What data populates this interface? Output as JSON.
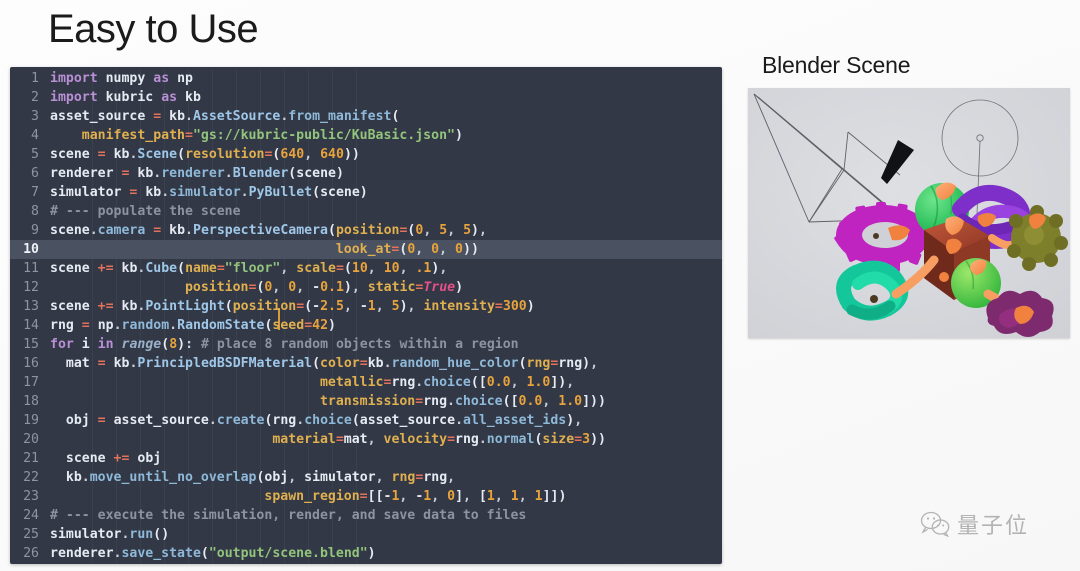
{
  "slide": {
    "title": "Easy to Use",
    "scene_heading": "Blender Scene"
  },
  "watermark": {
    "icon": "wechat-icon",
    "text": "量子位"
  },
  "code_panel": {
    "language": "python",
    "current_line": 10,
    "caret_line": 10,
    "theme": {
      "background": "#323845",
      "current_line_background": "#4a5161",
      "foreground": "#e6eaf2",
      "line_number": "#8d94a3",
      "keyword": "#b98fd6",
      "attribute": "#8fb9d9",
      "string": "#93c47d",
      "number": "#e8a33d",
      "kwarg": "#e0b050",
      "operator": "#e2725b",
      "comment": "#8c93a1",
      "boolean": "#e3508a",
      "caret": "#d99a3a"
    },
    "lines": [
      {
        "n": 1,
        "text": "import numpy as np"
      },
      {
        "n": 2,
        "text": "import kubric as kb"
      },
      {
        "n": 3,
        "text": "asset_source = kb.AssetSource.from_manifest("
      },
      {
        "n": 4,
        "text": "    manifest_path=\"gs://kubric-public/KuBasic.json\")"
      },
      {
        "n": 5,
        "text": "scene = kb.Scene(resolution=(640, 640))"
      },
      {
        "n": 6,
        "text": "renderer = kb.renderer.Blender(scene)"
      },
      {
        "n": 7,
        "text": "simulator = kb.simulator.PyBullet(scene)"
      },
      {
        "n": 8,
        "text": "# --- populate the scene"
      },
      {
        "n": 9,
        "text": "scene.camera = kb.PerspectiveCamera(position=(0, 5, 5),"
      },
      {
        "n": 10,
        "text": "                                    look_at=(0, 0, 0))"
      },
      {
        "n": 11,
        "text": "scene += kb.Cube(name=\"floor\", scale=(10, 10, .1),"
      },
      {
        "n": 12,
        "text": "                 position=(0, 0, -0.1), static=True)"
      },
      {
        "n": 13,
        "text": "scene += kb.PointLight(position=(-2.5, -1, 5), intensity=300)"
      },
      {
        "n": 14,
        "text": "rng = np.random.RandomState(seed=42)"
      },
      {
        "n": 15,
        "text": "for i in range(8): # place 8 random objects within a region"
      },
      {
        "n": 16,
        "text": "  mat = kb.PrincipledBSDFMaterial(color=kb.random_hue_color(rng=rng),"
      },
      {
        "n": 17,
        "text": "                                  metallic=rng.choice([0.0, 1.0]),"
      },
      {
        "n": 18,
        "text": "                                  transmission=rng.choice([0.0, 1.0]))"
      },
      {
        "n": 19,
        "text": "  obj = asset_source.create(rng.choice(asset_source.all_asset_ids),"
      },
      {
        "n": 20,
        "text": "                            material=mat, velocity=rng.normal(size=3))"
      },
      {
        "n": 21,
        "text": "  scene += obj"
      },
      {
        "n": 22,
        "text": "  kb.move_until_no_overlap(obj, simulator, rng=rng,"
      },
      {
        "n": 23,
        "text": "                           spawn_region=[[-1, -1, 0], [1, 1, 1]])"
      },
      {
        "n": 24,
        "text": "# --- execute the simulation, render, and save data to files"
      },
      {
        "n": 25,
        "text": "simulator.run()"
      },
      {
        "n": 26,
        "text": "renderer.save_state(\"output/scene.blend\")"
      }
    ]
  },
  "render_image": {
    "alt": "blender-viewport-render",
    "background": "#d4d6da",
    "elements": [
      "camera-wireframe",
      "light-circle-gizmo",
      "magenta-gear",
      "green-sphere",
      "purple-torus-knot",
      "red-cube",
      "teal-knot",
      "green-sphere-lower",
      "olive-spiky-object",
      "purple-blob"
    ]
  }
}
